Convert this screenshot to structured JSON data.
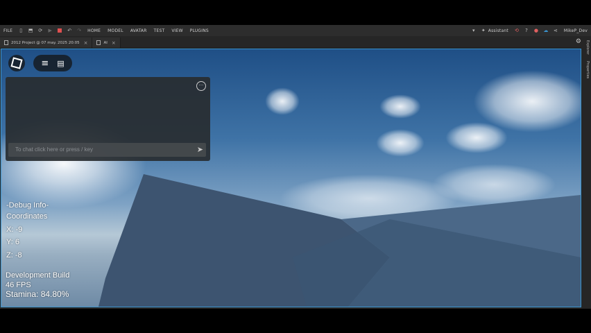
{
  "menubar": {
    "file": "FILE",
    "tabs": [
      "HOME",
      "MODEL",
      "AVATAR",
      "TEST",
      "VIEW",
      "PLUGINS"
    ],
    "assistant": "Assistant",
    "user": "MikeP_Dev"
  },
  "tabs": [
    {
      "label": "2012 Project @ 07 may. 2025 20:05"
    },
    {
      "label": "AI"
    }
  ],
  "side_panels": [
    "Explorer",
    "Properties"
  ],
  "chat": {
    "placeholder": "To chat click here or press / key"
  },
  "debug": {
    "title": "-Debug Info-",
    "coords_label": "Coordinates",
    "x": "X: -9",
    "y": "Y: 6",
    "z": "Z: -8",
    "build": "Development Build",
    "fps": "46 FPS",
    "stamina": "Stamina: 84.80%"
  },
  "colors": {
    "accent": "#3b95d0",
    "stop": "#e05050"
  }
}
